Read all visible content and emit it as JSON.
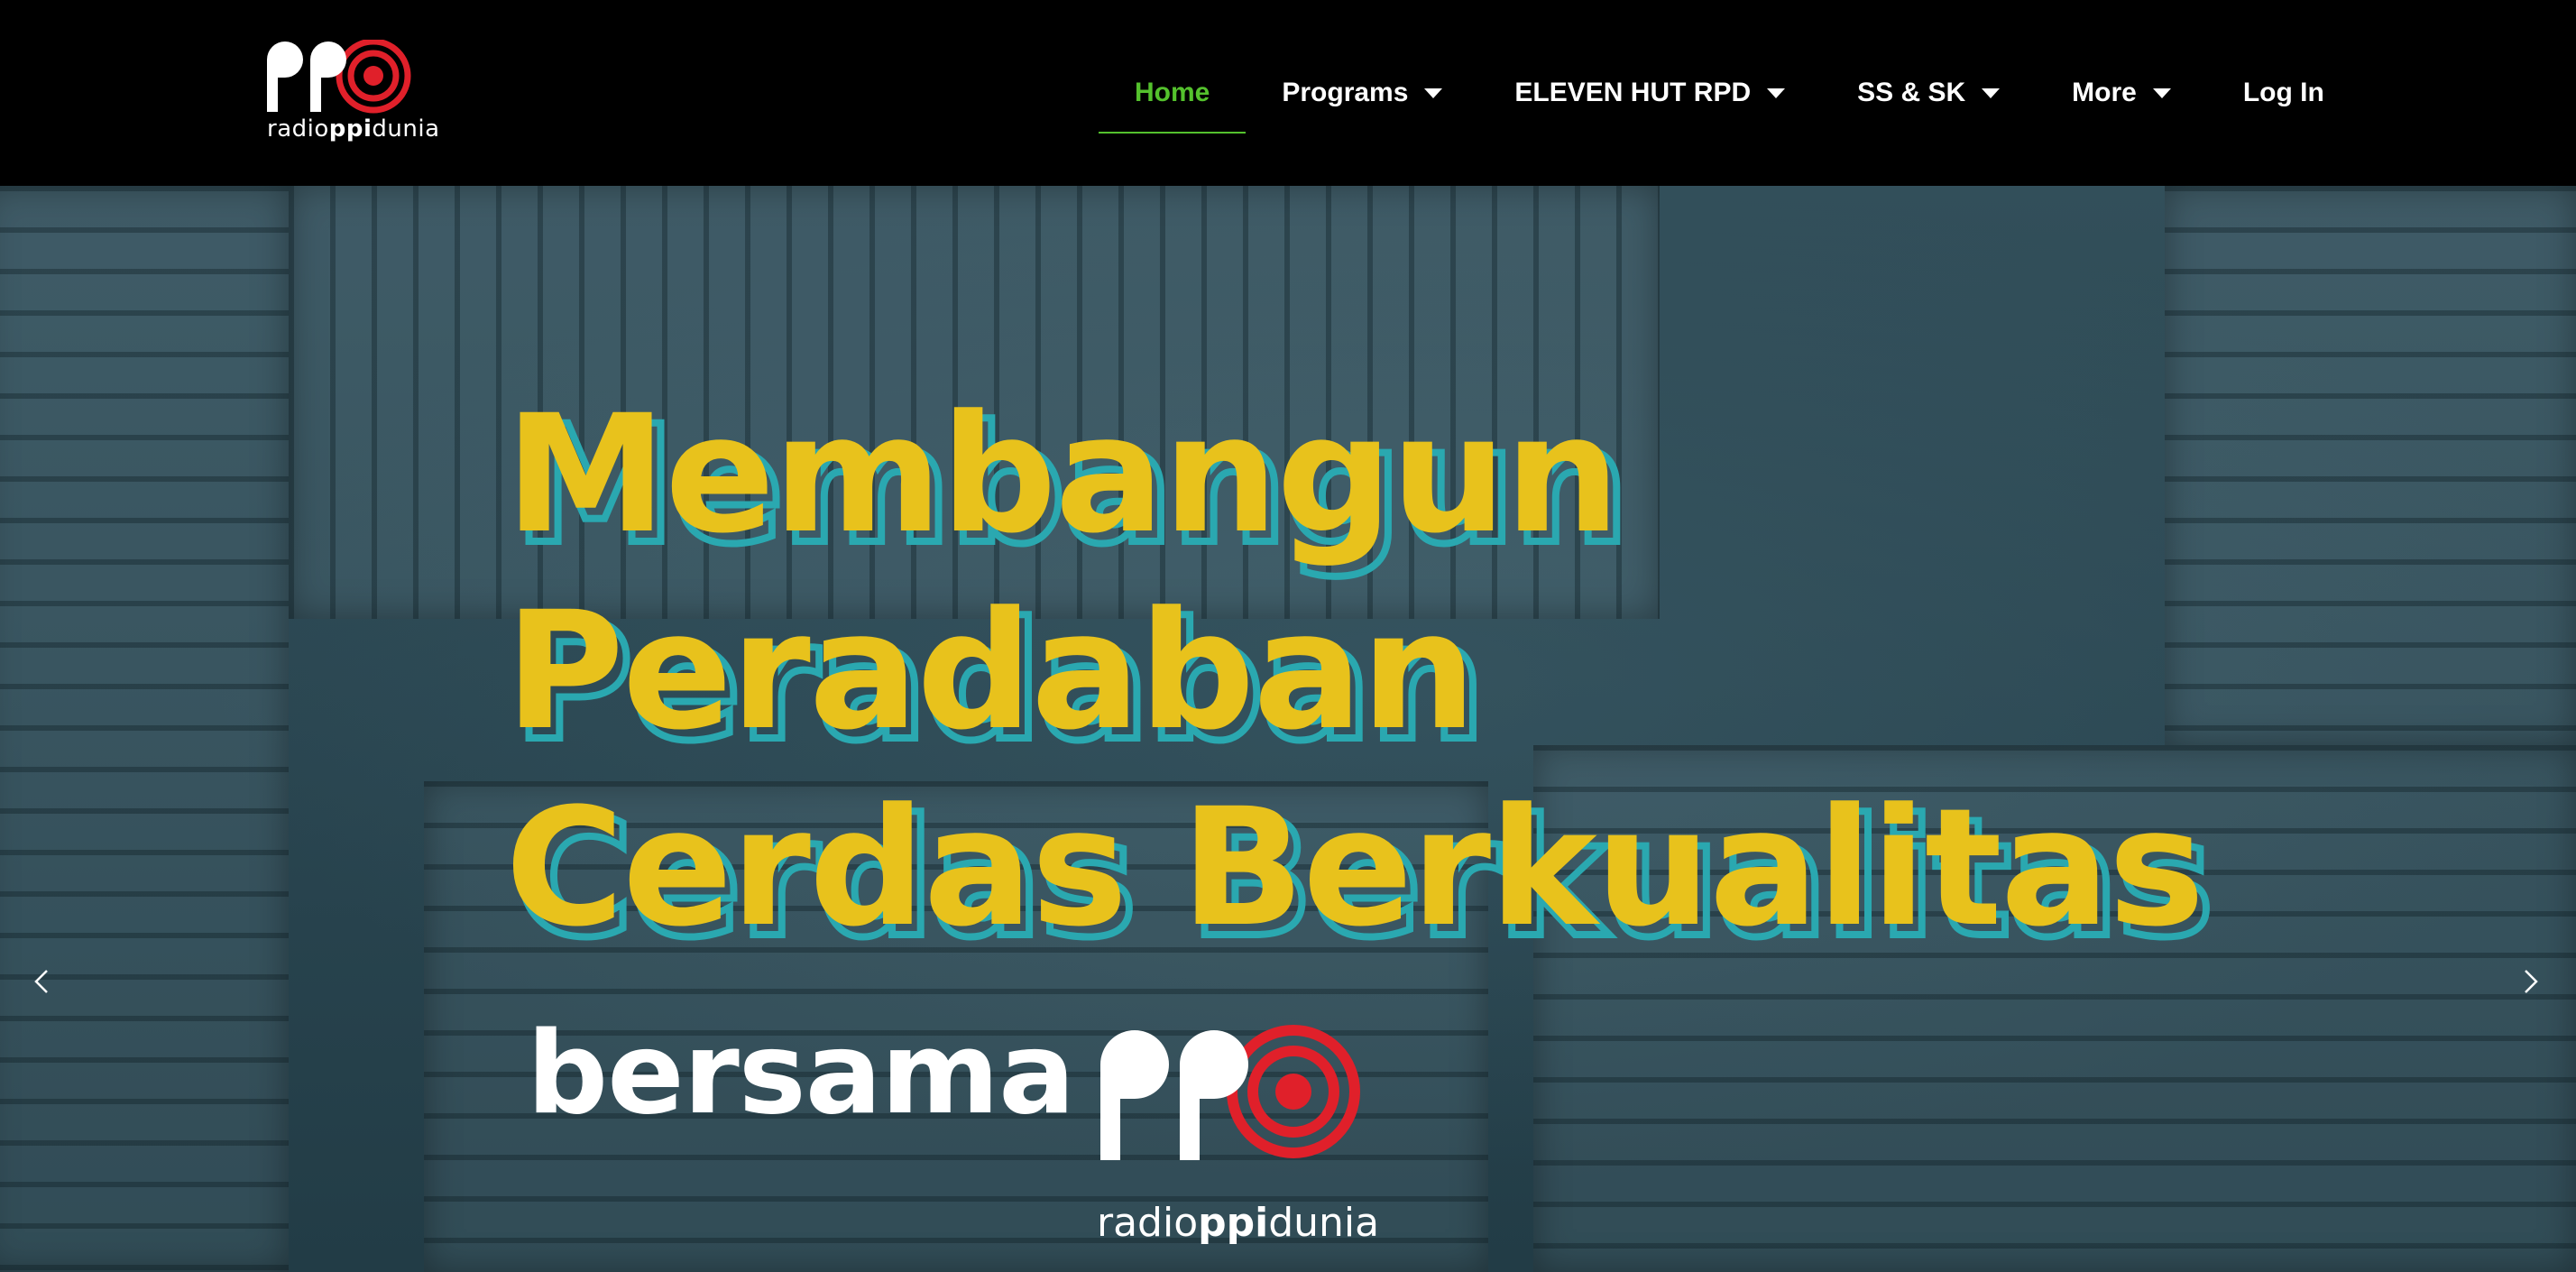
{
  "header": {
    "logo": {
      "text_prefix": "radio",
      "text_bold": "ppi",
      "text_suffix": "dunia",
      "icon": "radio-ppi-dunia-logo-icon"
    },
    "nav": [
      {
        "label": "Home",
        "active": true
      },
      {
        "label": "Programs",
        "dropdown": true
      },
      {
        "label": "ELEVEN HUT RPD",
        "dropdown": true
      },
      {
        "label": "SS & SK",
        "dropdown": true
      },
      {
        "label": "More",
        "dropdown": true
      },
      {
        "label": "Log In"
      }
    ]
  },
  "hero": {
    "headline": [
      "Membangun",
      "Peradaban",
      "Cerdas Berkualitas"
    ],
    "subline": "bersama",
    "logo": {
      "text_prefix": "radio",
      "text_bold": "ppi",
      "text_suffix": "dunia"
    },
    "prev_icon": "chevron-left-icon",
    "next_icon": "chevron-right-icon"
  },
  "colors": {
    "nav_active": "#54c12d",
    "headline": "#e8c21c",
    "headline_outline": "#2aa8b0",
    "logo_red": "#e0202a",
    "hero_bg": "#2d4a55"
  }
}
